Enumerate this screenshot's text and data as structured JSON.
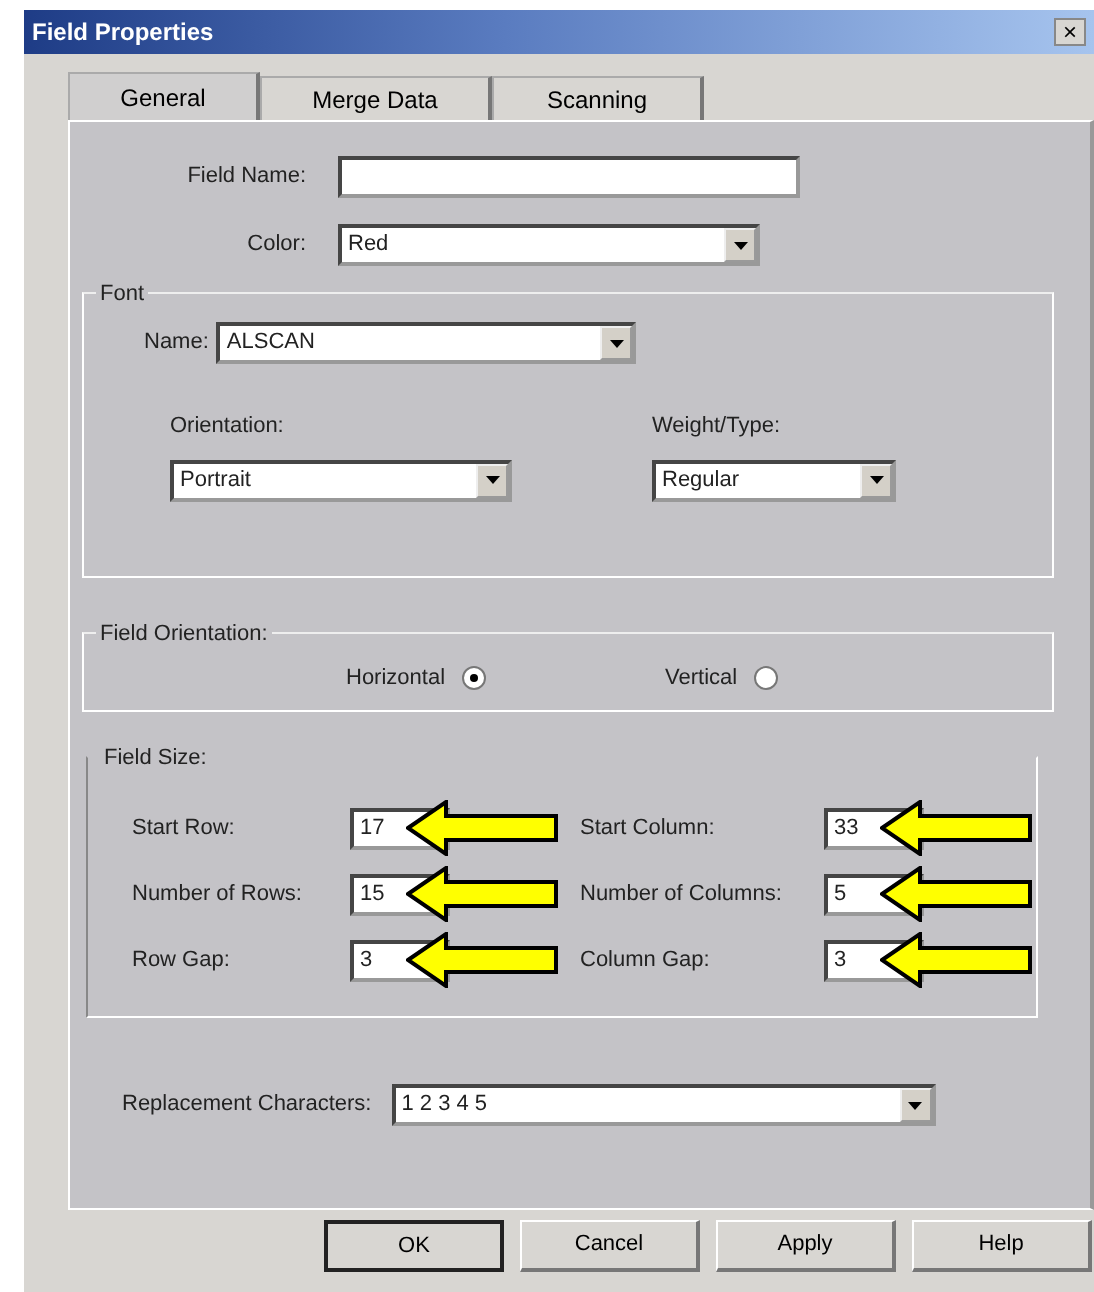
{
  "window": {
    "title": "Field Properties",
    "close": "×"
  },
  "tabs": [
    {
      "label": "General",
      "selected": true
    },
    {
      "label": "Merge Data",
      "selected": false
    },
    {
      "label": "Scanning",
      "selected": false
    }
  ],
  "field_name": {
    "label": "Field Name:"
  },
  "color": {
    "label": "Color:",
    "value": "Red"
  },
  "font": {
    "legend": "Font",
    "name": {
      "label": "Name:",
      "value": "ALSCAN"
    },
    "orientation": {
      "label": "Orientation:",
      "value": "Portrait"
    },
    "weight": {
      "label": "Weight/Type:",
      "value": "Regular"
    }
  },
  "field_orientation": {
    "legend": "Field Orientation:",
    "options": [
      {
        "label": "Horizontal",
        "selected": true
      },
      {
        "label": "Vertical",
        "selected": false
      }
    ]
  },
  "field_size": {
    "legend": "Field Size:",
    "fields": [
      {
        "label": "Start Row:",
        "value": "17",
        "arrow": true
      },
      {
        "label": "Start Column:",
        "value": "33",
        "arrow": true
      },
      {
        "label": "Number of Rows:",
        "value": "15",
        "arrow": true
      },
      {
        "label": "Number of Columns:",
        "value": "5",
        "arrow": true
      },
      {
        "label": "Row Gap:",
        "value": "3",
        "arrow": true
      },
      {
        "label": "Column Gap:",
        "value": "3",
        "arrow": true
      }
    ]
  },
  "replacement": {
    "label": "Replacement Characters:",
    "value": "1 2 3 4 5"
  },
  "buttons": [
    {
      "label": "OK",
      "default": true
    },
    {
      "label": "Cancel",
      "default": false
    },
    {
      "label": "Apply",
      "default": false
    },
    {
      "label": "Help",
      "default": false
    }
  ]
}
